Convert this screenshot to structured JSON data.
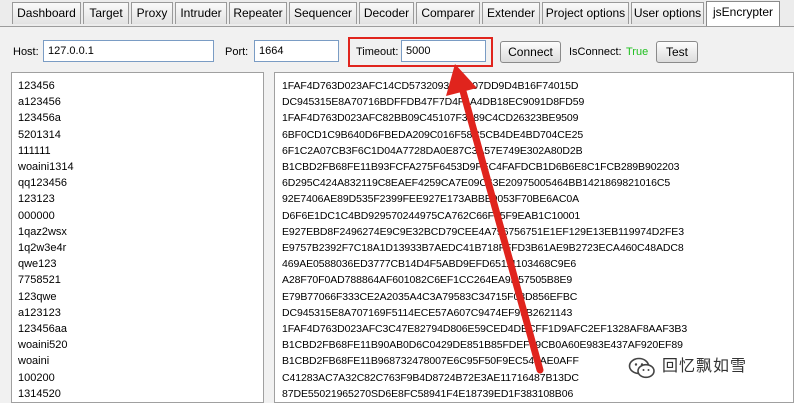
{
  "tabs": [
    {
      "label": "Dashboard"
    },
    {
      "label": "Target"
    },
    {
      "label": "Proxy"
    },
    {
      "label": "Intruder"
    },
    {
      "label": "Repeater"
    },
    {
      "label": "Sequencer"
    },
    {
      "label": "Decoder"
    },
    {
      "label": "Comparer"
    },
    {
      "label": "Extender"
    },
    {
      "label": "Project options"
    },
    {
      "label": "User options"
    },
    {
      "label": "jsEncrypter",
      "active": true
    }
  ],
  "connection": {
    "host_label": "Host:",
    "host_value": "127.0.0.1",
    "port_label": "Port:",
    "port_value": "1664",
    "timeout_label": "Timeout:",
    "timeout_value": "5000",
    "connect_label": "Connect",
    "isconnect_label": "IsConnect:",
    "isconnect_value": "True",
    "isconnect_color": "#1fbf1f",
    "test_label": "Test"
  },
  "annotation_color": "#e0241d",
  "plaintext_list": [
    "123456",
    "a123456",
    "123456a",
    "5201314",
    "111111",
    "woaini1314",
    "qq123456",
    "123123",
    "000000",
    "1qaz2wsx",
    "1q2w3e4r",
    "qwe123",
    "7758521",
    "123qwe",
    "a123123",
    "123456aa",
    "woaini520",
    "woaini",
    "100200",
    "1314520"
  ],
  "hash_list": [
    "1FAF4D763D023AFC14CD5732093520207DD9D4B16F74015D",
    "DC945315E8A70716BDFFDB47F7D4F4A4DB18EC9091D8FD59",
    "1FAF4D763D023AFC82BB09C45107F3289C4CD26323BE9509",
    "6BF0CD1C9B640D6FBEDA209C016F58C5CB4DE4BD704CE25",
    "6F1C2A07CB3F6C1D04A7728DA0E87C3A57E749E302A80D2B",
    "B1CBD2FB68FE11B93FCFA275F6453D9FEC4FAFDCB1D6B6E8C1FCB289B902203",
    "6D295C424A832119C8EAEF4259CA7E09C63E20975005464BB1421869821016C5",
    "92E7406AE89D535F2399FEE927E173ABBE9053F70BE6AC0A",
    "D6F6E1DC1C4BD929570244975CA762C66F15F9EAB1C10001",
    "E927EBD8F2496274E9C9E32BCD79CEE4A796756751E1EF129E13EB119974D2FE3",
    "E9757B2392F7C18A1D13933B7AEDC41B718FFFD3B61AE9B2723ECA460C48ADC8",
    "469AE0588036ED3777CB14D4F5ABD9EFD65111103468C9E6",
    "A28F70F0AD788864AF601082C6EF1CC264EA9D57505B8E9",
    "E79B77066F333CE2A2035A4C3A79583C34715F08D856EFBC",
    "DC945315E8A707169F5114ECE57A607C9474EF99B2621143",
    "1FAF4D763D023AFC3C47E82794D806E59CED4DBCFF1D9AFC2EF1328AF8AAF3B3",
    "B1CBD2FB68FE11B90AB0D6C0429DE851B85FDEF09CB0A60E983E437AF920EF89",
    "B1CBD2FB68FE11B968732478007E6C95F50F9EC540AE0AFF",
    "C41283AC7A32C82C763F9B4D8724B72E3AE11716487B13DC",
    "87DE55021965270SD6E8FC58941F4E18739ED1F383108B06"
  ],
  "watermark": {
    "icon": "wechat-icon",
    "text": "回忆飘如雪"
  }
}
